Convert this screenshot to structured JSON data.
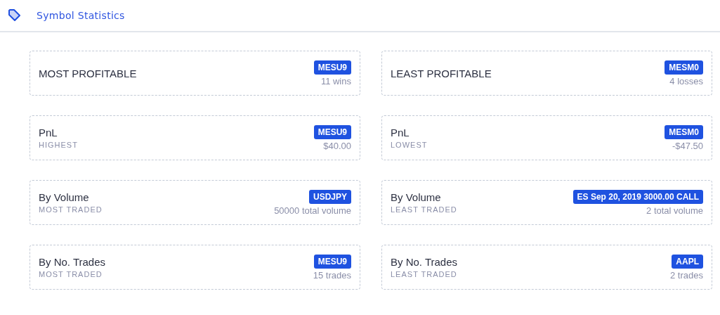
{
  "header": {
    "title": "Symbol Statistics"
  },
  "cards": [
    {
      "title": "MOST PROFITABLE",
      "symbol": "MESU9",
      "detail": "11 wins"
    },
    {
      "title": "LEAST PROFITABLE",
      "symbol": "MESM0",
      "detail": "4 losses"
    },
    {
      "title": "PnL",
      "subtitle": "HIGHEST",
      "symbol": "MESU9",
      "detail": "$40.00"
    },
    {
      "title": "PnL",
      "subtitle": "LOWEST",
      "symbol": "MESM0",
      "detail": "-$47.50"
    },
    {
      "title": "By Volume",
      "subtitle": "MOST TRADED",
      "symbol": "USDJPY",
      "detail": "50000 total volume"
    },
    {
      "title": "By Volume",
      "subtitle": "LEAST TRADED",
      "symbol": "ES Sep 20, 2019 3000.00 CALL",
      "detail": "2 total volume"
    },
    {
      "title": "By No. Trades",
      "subtitle": "MOST TRADED",
      "symbol": "MESU9",
      "detail": "15 trades"
    },
    {
      "title": "By No. Trades",
      "subtitle": "LEAST TRADED",
      "symbol": "AAPL",
      "detail": "2 trades"
    }
  ]
}
